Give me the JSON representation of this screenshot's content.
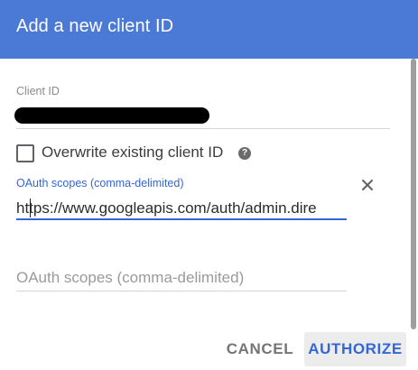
{
  "dialog": {
    "title": "Add a new client ID"
  },
  "client_id": {
    "label": "Client ID",
    "value_redacted": true
  },
  "overwrite": {
    "label": "Overwrite existing client ID",
    "checked": false,
    "help_icon": "help-circle-icon",
    "help_glyph": "?"
  },
  "scopes": {
    "active_label": "OAuth scopes (comma-delimited)",
    "active_value": "https://www.googleapis.com/auth/admin.dire",
    "clear_icon": "close-icon",
    "empty_placeholder": "OAuth scopes (comma-delimited)"
  },
  "actions": {
    "cancel_label": "CANCEL",
    "authorize_label": "AUTHORIZE"
  },
  "colors": {
    "header_bg": "#4a79d6",
    "accent": "#3367d6"
  }
}
